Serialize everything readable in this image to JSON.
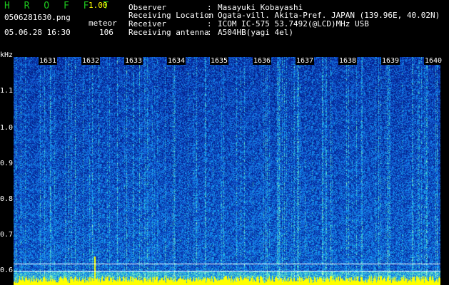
{
  "header": {
    "brand": "H R O F F T",
    "version": "1.00",
    "filename": "0506281630.png",
    "datetime": "05.06.28 16:30",
    "meteor_label": "meteor",
    "meteor_count": "106"
  },
  "info": {
    "rows": [
      {
        "label": "Observer",
        "value": "Masayuki Kobayashi"
      },
      {
        "label": "Receiving Location",
        "value": "Ogata-vill. Akita-Pref. JAPAN (139.96E, 40.02N)"
      },
      {
        "label": "Receiver",
        "value": "ICOM IC-575 53.7492(@LCD)MHz USB"
      },
      {
        "label": "Receiving antenna",
        "value": "A504HB(yagi 4el)"
      }
    ]
  },
  "y_axis": {
    "unit": "kHz",
    "labels": [
      "1.1",
      "1.0",
      "0.9",
      "0.8",
      "0.7",
      "0.6"
    ]
  },
  "time_ticks": [
    "1631",
    "1632",
    "1633",
    "1634",
    "1635",
    "1636",
    "1637",
    "1638",
    "1639",
    "1640"
  ],
  "colors": {
    "background": "#000000",
    "spectrogram_low": "#0a1a8a",
    "spectrogram_mid": "#1e5adc",
    "spectrogram_high": "#32d2c8",
    "baseline_noise": "#ffff00",
    "brand": "#1ec81e"
  }
}
